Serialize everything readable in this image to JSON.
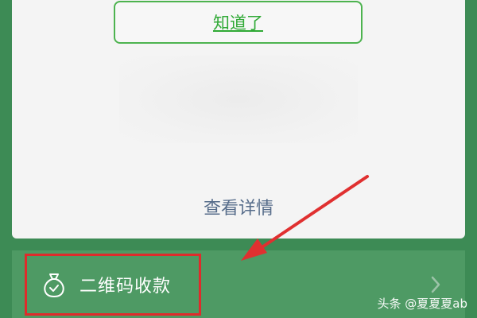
{
  "dialog": {
    "ok_button_label": "知道了",
    "details_link_label": "查看详情"
  },
  "action_bar": {
    "qr_payment_label": "二维码收款",
    "icon": "money-bag-icon",
    "chevron_icon": "chevron-right-icon"
  },
  "watermark": {
    "text": "头条 @夏夏夏ab"
  },
  "annotation": {
    "arrow_color": "#e03030",
    "highlight_color": "#df2b2b"
  },
  "colors": {
    "background": "#3d8b55",
    "card": "#f4f4f4",
    "accent_green": "#2fa935",
    "link_blue": "#566c8a"
  }
}
